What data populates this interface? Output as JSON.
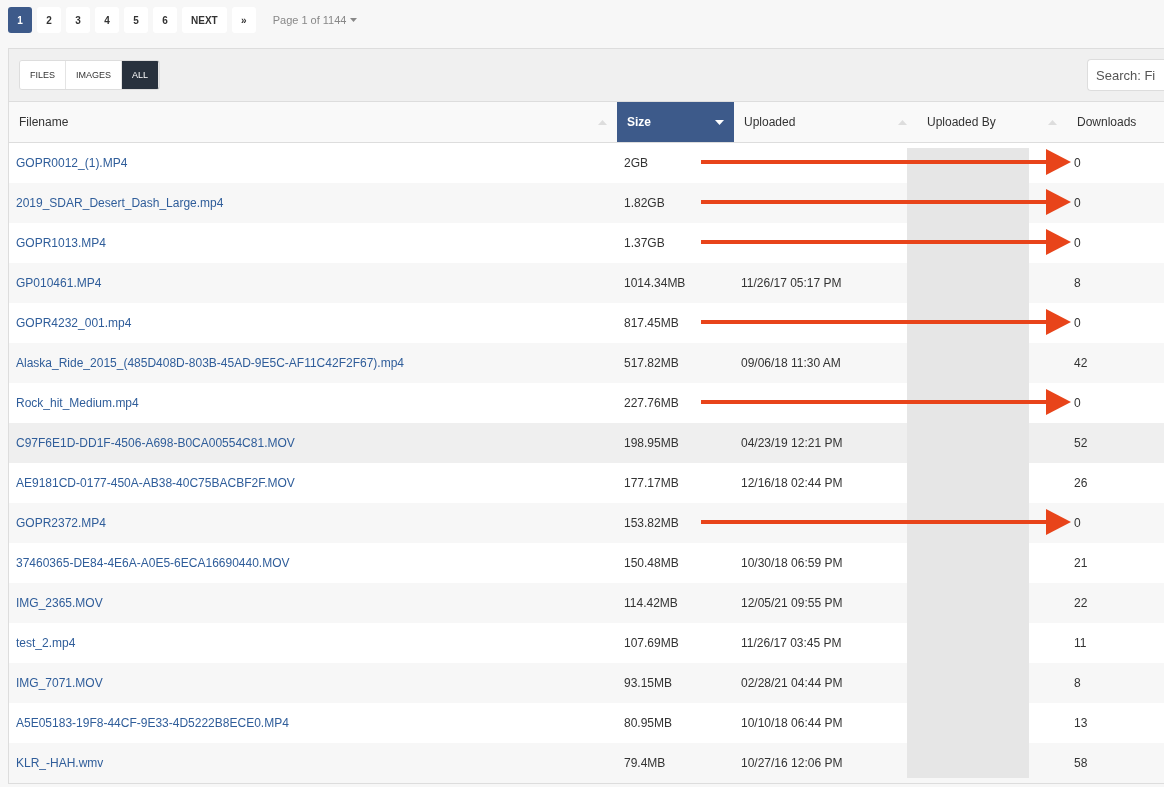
{
  "pagination": {
    "pages": [
      {
        "label": "1",
        "selected": true
      },
      {
        "label": "2",
        "selected": false
      },
      {
        "label": "3",
        "selected": false
      },
      {
        "label": "4",
        "selected": false
      },
      {
        "label": "5",
        "selected": false
      },
      {
        "label": "6",
        "selected": false
      },
      {
        "label": "NEXT",
        "selected": false
      },
      {
        "label": "»",
        "selected": false
      }
    ],
    "page_info": "Page 1 of 1144"
  },
  "filters": [
    {
      "label": "FILES",
      "selected": false
    },
    {
      "label": "IMAGES",
      "selected": false
    },
    {
      "label": "ALL",
      "selected": true
    }
  ],
  "search": {
    "placeholder": "Search: Fi"
  },
  "table": {
    "uploaded_by_redacted": true,
    "columns": [
      {
        "label": "Filename",
        "selected": false,
        "sort_icon": true
      },
      {
        "label": "Size",
        "selected": true,
        "sort_icon": true
      },
      {
        "label": "Uploaded",
        "selected": false,
        "sort_icon": true
      },
      {
        "label": "Uploaded By",
        "selected": false,
        "sort_icon": true
      },
      {
        "label": "Downloads",
        "selected": false,
        "sort_icon": false
      }
    ],
    "rows": [
      {
        "filename": "GOPR0012_(1).MP4",
        "size": "2GB",
        "downloads": "0",
        "arrow": true,
        "highlighted": false
      },
      {
        "filename": "2019_SDAR_Desert_Dash_Large.mp4",
        "size": "1.82GB",
        "downloads": "0",
        "arrow": true,
        "highlighted": false
      },
      {
        "filename": "GOPR1013.MP4",
        "size": "1.37GB",
        "downloads": "0",
        "arrow": true,
        "highlighted": false
      },
      {
        "filename": "GP010461.MP4",
        "size": "1014.34MB",
        "uploaded": "11/26/17 05:17 PM",
        "downloads": "8",
        "arrow": false,
        "highlighted": false
      },
      {
        "filename": "GOPR4232_001.mp4",
        "size": "817.45MB",
        "downloads": "0",
        "arrow": true,
        "highlighted": false
      },
      {
        "filename": "Alaska_Ride_2015_(485D408D-803B-45AD-9E5C-AF11C42F2F67).mp4",
        "size": "517.82MB",
        "uploaded": "09/06/18 11:30 AM",
        "downloads": "42",
        "arrow": false,
        "highlighted": false
      },
      {
        "filename": "Rock_hit_Medium.mp4",
        "size": "227.76MB",
        "downloads": "0",
        "arrow": true,
        "highlighted": false
      },
      {
        "filename": "C97F6E1D-DD1F-4506-A698-B0CA00554C81.MOV",
        "size": "198.95MB",
        "uploaded": "04/23/19 12:21 PM",
        "downloads": "52",
        "arrow": false,
        "highlighted": true
      },
      {
        "filename": "AE9181CD-0177-450A-AB38-40C75BACBF2F.MOV",
        "size": "177.17MB",
        "uploaded": "12/16/18 02:44 PM",
        "downloads": "26",
        "arrow": false,
        "highlighted": false
      },
      {
        "filename": "GOPR2372.MP4",
        "size": "153.82MB",
        "downloads": "0",
        "arrow": true,
        "highlighted": false
      },
      {
        "filename": "37460365-DE84-4E6A-A0E5-6ECA16690440.MOV",
        "size": "150.48MB",
        "uploaded": "10/30/18 06:59 PM",
        "downloads": "21",
        "arrow": false,
        "highlighted": false
      },
      {
        "filename": "IMG_2365.MOV",
        "size": "114.42MB",
        "uploaded": "12/05/21 09:55 PM",
        "downloads": "22",
        "arrow": false,
        "highlighted": false
      },
      {
        "filename": "test_2.mp4",
        "size": "107.69MB",
        "uploaded": "11/26/17 03:45 PM",
        "downloads": "11",
        "arrow": false,
        "highlighted": false
      },
      {
        "filename": "IMG_7071.MOV",
        "size": "93.15MB",
        "uploaded": "02/28/21 04:44 PM",
        "downloads": "8",
        "arrow": false,
        "highlighted": false
      },
      {
        "filename": "A5E05183-19F8-44CF-9E33-4D5222B8ECE0.MP4",
        "size": "80.95MB",
        "uploaded": "10/10/18 06:44 PM",
        "downloads": "13",
        "arrow": false,
        "highlighted": false
      },
      {
        "filename": "KLR_-HAH.wmv",
        "size": "79.4MB",
        "uploaded": "10/27/16 12:06 PM",
        "downloads": "58",
        "arrow": false,
        "highlighted": false
      }
    ]
  }
}
